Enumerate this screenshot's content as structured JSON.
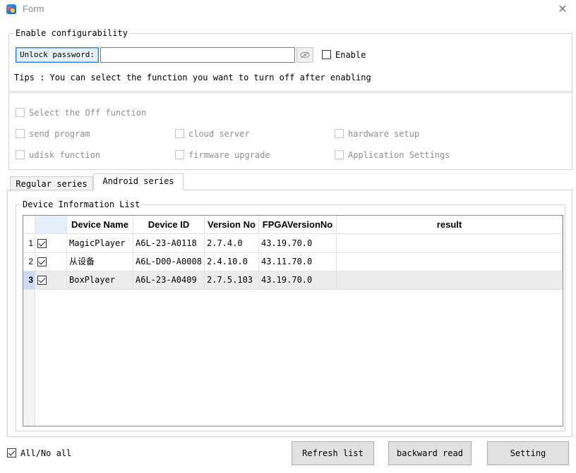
{
  "window": {
    "title": "Form"
  },
  "config": {
    "group_label": "Enable configurability",
    "unlock_label": "Unlock password:",
    "password_value": "",
    "enable_label": "Enable",
    "tips": "Tips : You can select the function you want to turn off after enabling"
  },
  "off_functions": {
    "select_label": "Select the Off function",
    "items": [
      "send program",
      "cloud server",
      "hardware setup",
      "udisk function",
      "firmware upgrade",
      "Application Settings"
    ]
  },
  "tabs": [
    "Regular series",
    "Android series"
  ],
  "device_list": {
    "group_label": "Device Information List",
    "columns": [
      "Device Name",
      "Device ID",
      "Version No",
      "FPGAVersionNo",
      "result"
    ],
    "rows": [
      {
        "num": "1",
        "name": "MagicPlayer",
        "id": "A6L-23-A0118",
        "version": "2.7.4.0",
        "fpga": "43.19.70.0",
        "result": ""
      },
      {
        "num": "2",
        "name": "从设备",
        "id": "A6L-D00-A0008",
        "version": "2.4.10.0",
        "fpga": "43.11.70.0",
        "result": ""
      },
      {
        "num": "3",
        "name": "BoxPlayer",
        "id": "A6L-23-A0409",
        "version": "2.7.5.103",
        "fpga": "43.19.70.0",
        "result": ""
      }
    ]
  },
  "footer": {
    "all_label": "All/No all",
    "refresh_label": "Refresh list",
    "backward_label": "backward read",
    "setting_label": "Setting"
  }
}
